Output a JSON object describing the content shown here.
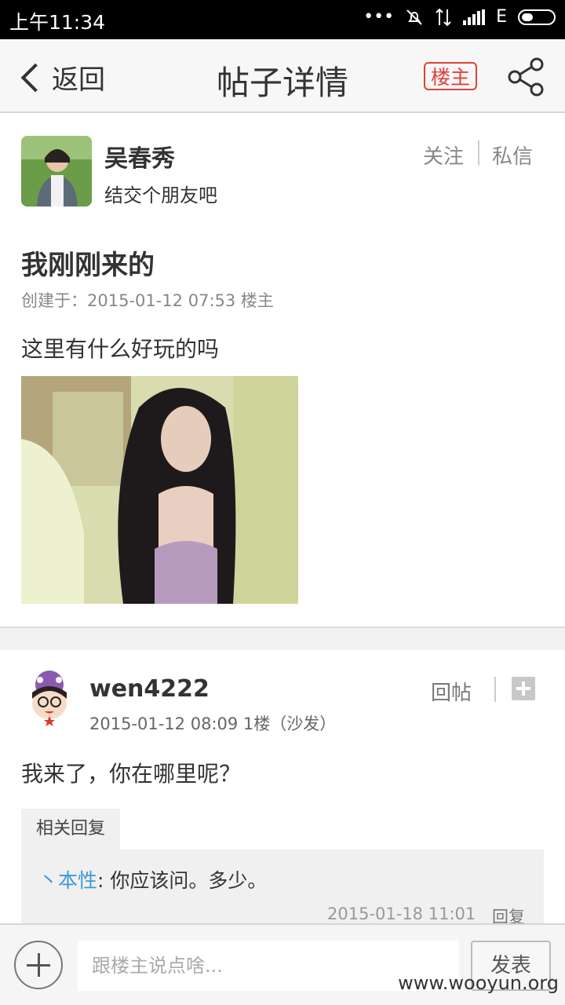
{
  "status_bar": {
    "time": "上午11:34",
    "network": "E"
  },
  "nav": {
    "back_label": "返回",
    "title": "帖子详情",
    "owner_badge": "楼主"
  },
  "author": {
    "name": "吴春秀",
    "signature": "结交个朋友吧",
    "follow_label": "关注",
    "message_label": "私信"
  },
  "post": {
    "title": "我刚刚来的",
    "meta": "创建于：2015-01-12 07:53   楼主",
    "body": "这里有什么好玩的吗"
  },
  "reply": {
    "username": "wen4222",
    "meta": "2015-01-12 08:09   1楼（沙发）",
    "reply_label": "回帖",
    "text": "我来了，你在哪里呢？",
    "related": {
      "tab_label": "相关回复",
      "author": "丶本性",
      "separator": ": ",
      "text": "你应该问。多少。",
      "time": "2015-01-18 11:01",
      "reply_label": "回复"
    }
  },
  "composer": {
    "placeholder": "跟楼主说点啥...",
    "send_label": "发表"
  },
  "watermark": "www.wooyun.org"
}
